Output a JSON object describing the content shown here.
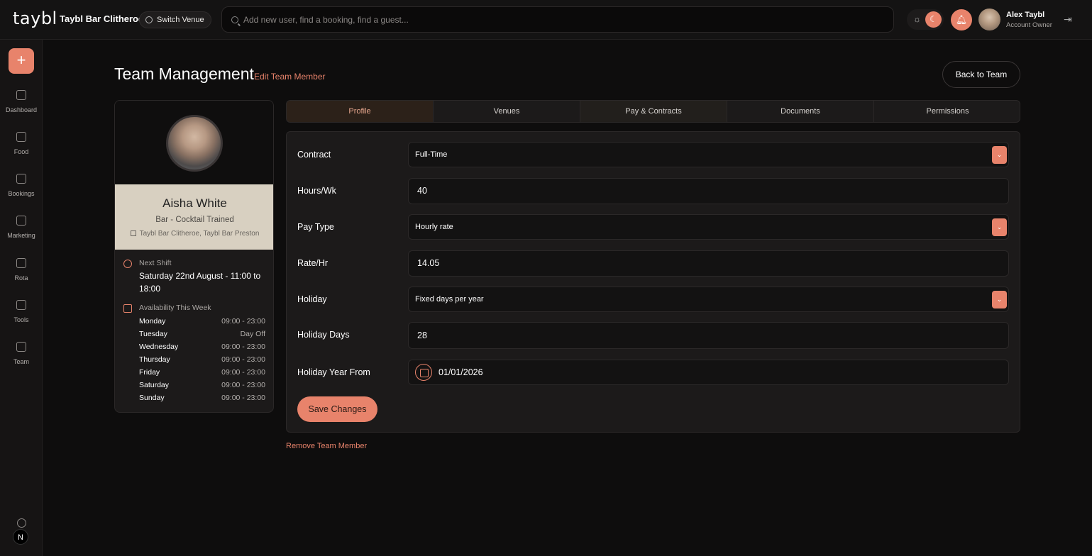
{
  "brand": {
    "logo_text": "taybl",
    "accent": "#e8836b"
  },
  "header": {
    "venue_name": "Taybl Bar Clitheroe",
    "switch_venue_label": "Switch Venue",
    "search_placeholder": "Add new user, find a booking, find a guest...",
    "user_name": "Alex Taybl",
    "user_role": "Account Owner"
  },
  "sidebar": {
    "items": [
      {
        "label": "Dashboard",
        "icon": "dashboard-icon"
      },
      {
        "label": "Food",
        "icon": "food-icon"
      },
      {
        "label": "Bookings",
        "icon": "bookings-icon"
      },
      {
        "label": "Marketing",
        "icon": "marketing-icon"
      },
      {
        "label": "Rota",
        "icon": "rota-icon"
      },
      {
        "label": "Tools",
        "icon": "tools-icon"
      },
      {
        "label": "Team",
        "icon": "team-icon"
      }
    ],
    "badge": "N"
  },
  "page": {
    "title": "Team Management",
    "subtitle": "Edit Team Member",
    "back_label": "Back to Team"
  },
  "profile": {
    "name": "Aisha White",
    "role": "Bar - Cocktail Trained",
    "venues": "Taybl Bar Clitheroe, Taybl Bar Preston",
    "next_shift_label": "Next Shift",
    "next_shift_value": "Saturday 22nd August - 11:00 to 18:00",
    "availability_label": "Availability This Week",
    "availability": [
      {
        "day": "Monday",
        "time": "09:00 - 23:00"
      },
      {
        "day": "Tuesday",
        "time": "Day Off"
      },
      {
        "day": "Wednesday",
        "time": "09:00 - 23:00"
      },
      {
        "day": "Thursday",
        "time": "09:00 - 23:00"
      },
      {
        "day": "Friday",
        "time": "09:00 - 23:00"
      },
      {
        "day": "Saturday",
        "time": "09:00 - 23:00"
      },
      {
        "day": "Sunday",
        "time": "09:00 - 23:00"
      }
    ]
  },
  "tabs": [
    "Profile",
    "Venues",
    "Pay & Contracts",
    "Documents",
    "Permissions"
  ],
  "form": {
    "contract": {
      "label": "Contract",
      "value": "Full-Time"
    },
    "hours": {
      "label": "Hours/Wk",
      "value": "40"
    },
    "pay_type": {
      "label": "Pay Type",
      "value": "Hourly rate"
    },
    "rate": {
      "label": "Rate/Hr",
      "value": "14.05"
    },
    "holiday": {
      "label": "Holiday",
      "value": "Fixed days per year"
    },
    "holiday_days": {
      "label": "Holiday Days",
      "value": "28"
    },
    "holiday_year_from": {
      "label": "Holiday Year From",
      "value": "01/01/2026"
    },
    "save_label": "Save Changes",
    "remove_label": "Remove Team Member"
  }
}
